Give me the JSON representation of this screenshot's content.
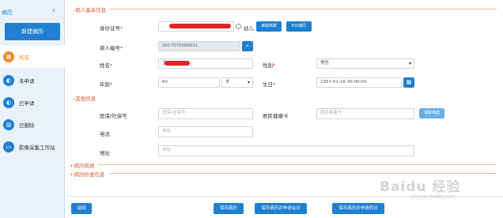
{
  "sidebar": {
    "title": "病历",
    "new_button": "新建病历",
    "items": [
      {
        "label": "所有"
      },
      {
        "label": "未申请"
      },
      {
        "label": "已申请"
      },
      {
        "label": "已删除"
      },
      {
        "label": "影像采集工作站"
      }
    ]
  },
  "basic": {
    "section": "病人基本信息",
    "id_card": {
      "label": "身份证号",
      "radio_label": "幼儿"
    },
    "read_card_btn": "读取档案",
    "hd_btn": "HIS病历",
    "patient_no": {
      "label": "病人编号",
      "value": "2017070000011"
    },
    "name": {
      "label": "姓名",
      "value": "王"
    },
    "gender": {
      "label": "性别",
      "value": "男性"
    },
    "age": {
      "label": "年龄",
      "value": "60",
      "unit": "岁"
    },
    "birthday": {
      "label": "生日",
      "value": "1957-01-16 00:00:00"
    }
  },
  "other": {
    "section": "其他信息",
    "insurance": {
      "label": "医保/社保号",
      "placeholder": "医保/社保号"
    },
    "health_card": {
      "label": "居民健康卡",
      "placeholder": "居民健康卡"
    },
    "read_btn": "读取档案",
    "phone": {
      "label": "电话",
      "placeholder": "电话"
    },
    "address": {
      "label": "地址",
      "placeholder": "地址"
    }
  },
  "collapsed": {
    "history": "病历简述",
    "exam": "病历检查信息"
  },
  "footer": {
    "back": "返回",
    "save": "保存病历",
    "save_apply": "保存病历并申请会诊",
    "save_transfer": "保存病历并申请转诊"
  },
  "watermark": {
    "text": "Baidu 经验",
    "sub": "jingyan.baidu.com"
  },
  "colors": {
    "primary": "#1f7fd0",
    "accent": "#f08a24",
    "section": "#d45a2a"
  }
}
